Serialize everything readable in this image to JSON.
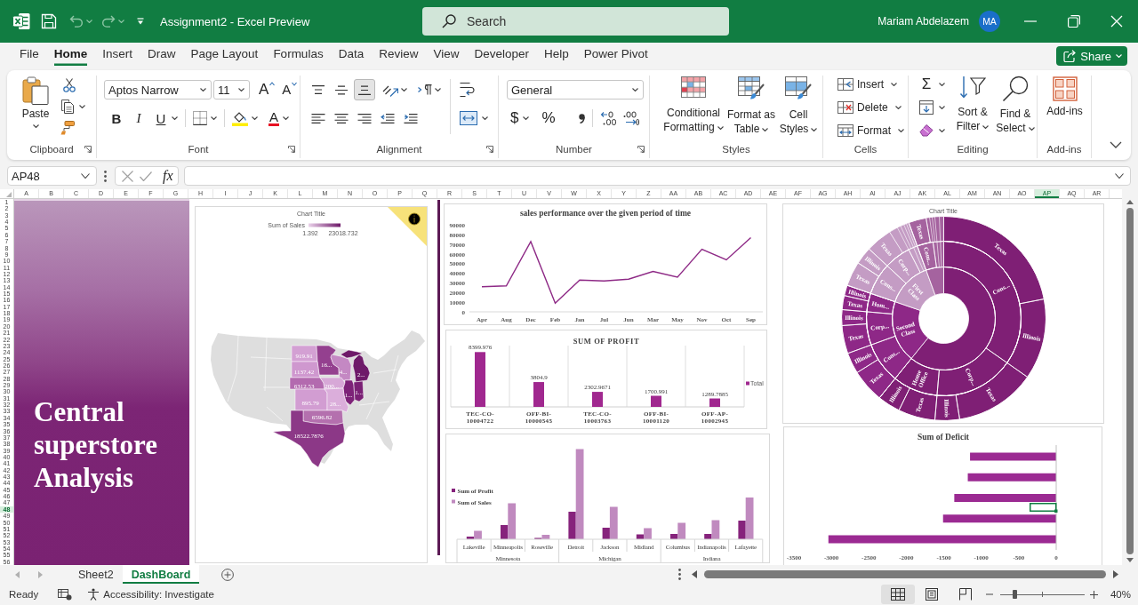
{
  "title_bar": {
    "title": "Assignment2 - Excel Preview",
    "search": {
      "placeholder": "Search"
    },
    "user_name": "Mariam Abdelazem",
    "avatar": "MA"
  },
  "menu_tabs": [
    {
      "label": "File",
      "selected": false
    },
    {
      "label": "Home",
      "selected": true
    },
    {
      "label": "Insert",
      "selected": false
    },
    {
      "label": "Draw",
      "selected": false
    },
    {
      "label": "Page Layout",
      "selected": false
    },
    {
      "label": "Formulas",
      "selected": false
    },
    {
      "label": "Data",
      "selected": false
    },
    {
      "label": "Review",
      "selected": false
    },
    {
      "label": "View",
      "selected": false
    },
    {
      "label": "Developer",
      "selected": false
    },
    {
      "label": "Help",
      "selected": false
    },
    {
      "label": "Power Pivot",
      "selected": false
    }
  ],
  "share_button": "Share",
  "ribbon": {
    "clipboard": {
      "paste": "Paste",
      "label": "Clipboard"
    },
    "font": {
      "font_name": "Aptos Narrow",
      "font_size": "11",
      "grow": "A",
      "shrink": "A",
      "bold": "B",
      "italic": "I",
      "underline": "U",
      "font_color": "A",
      "label": "Font"
    },
    "alignment": {
      "vertical": [
        {
          "kind": "top",
          "selected": false
        },
        {
          "kind": "middle",
          "selected": false
        },
        {
          "kind": "bottom",
          "selected": true
        }
      ],
      "label": "Alignment"
    },
    "number": {
      "format": "General",
      "currency": "$",
      "percent": "%",
      "label": "Number"
    },
    "styles": {
      "buttons": [
        {
          "kind": "conditional",
          "label": "Conditional Formatting"
        },
        {
          "kind": "table",
          "label": "Format as Table"
        },
        {
          "kind": "cell",
          "label": "Cell Styles"
        }
      ],
      "label": "Styles"
    },
    "cells": {
      "buttons": [
        {
          "kind": "insert",
          "label": "Insert"
        },
        {
          "kind": "delete",
          "label": "Delete"
        },
        {
          "kind": "format",
          "label": "Format"
        }
      ],
      "label": "Cells"
    },
    "editing": {
      "sum": "Σ",
      "buttons": [
        {
          "kind": "sort",
          "label": "Sort & Filter"
        },
        {
          "kind": "find",
          "label": "Find & Select"
        }
      ],
      "label": "Editing"
    },
    "addins": {
      "button": "Add-ins",
      "label": "Add-ins"
    }
  },
  "formula_bar": {
    "name_box": "AP48",
    "function_button": "fx"
  },
  "columns": [
    {
      "label": "A",
      "selected": false
    },
    {
      "label": "B",
      "selected": false
    },
    {
      "label": "C",
      "selected": false
    },
    {
      "label": "D",
      "selected": false
    },
    {
      "label": "E",
      "selected": false
    },
    {
      "label": "F",
      "selected": false
    },
    {
      "label": "G",
      "selected": false
    },
    {
      "label": "H",
      "selected": false
    },
    {
      "label": "I",
      "selected": false
    },
    {
      "label": "J",
      "selected": false
    },
    {
      "label": "K",
      "selected": false
    },
    {
      "label": "L",
      "selected": false
    },
    {
      "label": "M",
      "selected": false
    },
    {
      "label": "N",
      "selected": false
    },
    {
      "label": "O",
      "selected": false
    },
    {
      "label": "P",
      "selected": false
    },
    {
      "label": "Q",
      "selected": false
    },
    {
      "label": "R",
      "selected": false
    },
    {
      "label": "S",
      "selected": false
    },
    {
      "label": "T",
      "selected": false
    },
    {
      "label": "U",
      "selected": false
    },
    {
      "label": "V",
      "selected": false
    },
    {
      "label": "W",
      "selected": false
    },
    {
      "label": "X",
      "selected": false
    },
    {
      "label": "Y",
      "selected": false
    },
    {
      "label": "Z",
      "selected": false
    },
    {
      "label": "AA",
      "selected": false
    },
    {
      "label": "AB",
      "selected": false
    },
    {
      "label": "AC",
      "selected": false
    },
    {
      "label": "AD",
      "selected": false
    },
    {
      "label": "AE",
      "selected": false
    },
    {
      "label": "AF",
      "selected": false
    },
    {
      "label": "AG",
      "selected": false
    },
    {
      "label": "AH",
      "selected": false
    },
    {
      "label": "AI",
      "selected": false
    },
    {
      "label": "AJ",
      "selected": false
    },
    {
      "label": "AK",
      "selected": false
    },
    {
      "label": "AL",
      "selected": false
    },
    {
      "label": "AM",
      "selected": false
    },
    {
      "label": "AN",
      "selected": false
    },
    {
      "label": "AO",
      "selected": false
    },
    {
      "label": "AP",
      "selected": true
    },
    {
      "label": "AQ",
      "selected": false
    },
    {
      "label": "AR",
      "selected": false
    }
  ],
  "rows": [
    {
      "label": "1",
      "selected": false
    },
    {
      "label": "2",
      "selected": false
    },
    {
      "label": "3",
      "selected": false
    },
    {
      "label": "4",
      "selected": false
    },
    {
      "label": "5",
      "selected": false
    },
    {
      "label": "6",
      "selected": false
    },
    {
      "label": "7",
      "selected": false
    },
    {
      "label": "8",
      "selected": false
    },
    {
      "label": "9",
      "selected": false
    },
    {
      "label": "10",
      "selected": false
    },
    {
      "label": "11",
      "selected": false
    },
    {
      "label": "12",
      "selected": false
    },
    {
      "label": "13",
      "selected": false
    },
    {
      "label": "14",
      "selected": false
    },
    {
      "label": "15",
      "selected": false
    },
    {
      "label": "16",
      "selected": false
    },
    {
      "label": "17",
      "selected": false
    },
    {
      "label": "18",
      "selected": false
    },
    {
      "label": "19",
      "selected": false
    },
    {
      "label": "20",
      "selected": false
    },
    {
      "label": "21",
      "selected": false
    },
    {
      "label": "22",
      "selected": false
    },
    {
      "label": "23",
      "selected": false
    },
    {
      "label": "24",
      "selected": false
    },
    {
      "label": "25",
      "selected": false
    },
    {
      "label": "26",
      "selected": false
    },
    {
      "label": "27",
      "selected": false
    },
    {
      "label": "28",
      "selected": false
    },
    {
      "label": "29",
      "selected": false
    },
    {
      "label": "30",
      "selected": false
    },
    {
      "label": "31",
      "selected": false
    },
    {
      "label": "32",
      "selected": false
    },
    {
      "label": "33",
      "selected": false
    },
    {
      "label": "34",
      "selected": false
    },
    {
      "label": "35",
      "selected": false
    },
    {
      "label": "36",
      "selected": false
    },
    {
      "label": "37",
      "selected": false
    },
    {
      "label": "38",
      "selected": false
    },
    {
      "label": "39",
      "selected": false
    },
    {
      "label": "40",
      "selected": false
    },
    {
      "label": "41",
      "selected": false
    },
    {
      "label": "42",
      "selected": false
    },
    {
      "label": "43",
      "selected": false
    },
    {
      "label": "44",
      "selected": false
    },
    {
      "label": "45",
      "selected": false
    },
    {
      "label": "46",
      "selected": false
    },
    {
      "label": "47",
      "selected": false
    },
    {
      "label": "48",
      "selected": true
    },
    {
      "label": "49",
      "selected": false
    },
    {
      "label": "50",
      "selected": false
    },
    {
      "label": "51",
      "selected": false
    },
    {
      "label": "52",
      "selected": false
    },
    {
      "label": "53",
      "selected": false
    },
    {
      "label": "54",
      "selected": false
    },
    {
      "label": "55",
      "selected": false
    },
    {
      "label": "56",
      "selected": false
    }
  ],
  "dashboard": {
    "banner": {
      "text": "Central superstore Analysis"
    },
    "map_chart": {
      "title": "Chart Title",
      "legend": {
        "title": "Sum of Sales",
        "min": "1.392",
        "max": "23018.732"
      },
      "regions": [
        {
          "label": "919.91",
          "color": "#d3a0d3"
        },
        {
          "label": "16...",
          "color": "#94408f"
        },
        {
          "label": "1137.42",
          "color": "#cf98cf"
        },
        {
          "label": "4...",
          "color": "#c488c3"
        },
        {
          "label": "2...",
          "color": "#6e1a69"
        },
        {
          "label": "6312.53",
          "color": "#b36aaf"
        },
        {
          "label": "200...",
          "color": "#d7a8d7"
        },
        {
          "label": "1...",
          "color": "#7d2278"
        },
        {
          "label": "1...",
          "color": "#7a2075"
        },
        {
          "label": "895.79",
          "color": "#d29dd2"
        },
        {
          "label": "28...",
          "color": "#dbaedb"
        },
        {
          "label": "6596.82",
          "color": "#b470ae"
        },
        {
          "label": "18522.7876",
          "color": "#8c3887"
        }
      ]
    },
    "sales_chart": {
      "chart_data": {
        "type": "line",
        "title": "sales performance over the given period of time",
        "categories": [
          "Apr",
          "Aug",
          "Dec",
          "Feb",
          "Jan",
          "Jul",
          "Jun",
          "Mar",
          "May",
          "Nov",
          "Oct",
          "Sep"
        ],
        "values": [
          26000,
          27000,
          73000,
          9000,
          33000,
          32000,
          34000,
          42000,
          36000,
          65000,
          54000,
          77000
        ],
        "color": "#8e2a86",
        "ylim": [
          0,
          90000
        ],
        "yticks": [
          0,
          10000,
          20000,
          30000,
          40000,
          50000,
          60000,
          70000,
          80000,
          90000
        ]
      }
    },
    "profit_chart": {
      "chart_data": {
        "type": "bar",
        "title": "SUM OF PROFIT",
        "categories": [
          "TEC-CO-10004722",
          "OFF-BI-10000545",
          "TEC-CO-10003763",
          "OFF-BI-10001120",
          "OFF-AP-10002945"
        ],
        "series": [
          {
            "name": "Total",
            "color": "#a0288f",
            "values": [
              8399.976,
              3804.9,
              2302.9671,
              1700.991,
              1289.7885
            ]
          }
        ],
        "data_labels": true,
        "legend": "right"
      }
    },
    "city_chart": {
      "legend": [
        {
          "label": "Sum of Profit",
          "color": "#86237c"
        },
        {
          "label": "Sum of Sales",
          "color": "#c08abf"
        }
      ],
      "groups": [
        {
          "label": "Minnesota",
          "categories": [
            "Lakeville",
            "Minneapolis",
            "Roseville"
          ]
        },
        {
          "label": "Michigan",
          "categories": [
            "Detroit",
            "Jackson",
            "Midland"
          ]
        },
        {
          "label": "Indiana",
          "categories": [
            "Columbus",
            "Indianapolis",
            "Lafayette"
          ]
        }
      ]
    },
    "sunburst": {
      "title": "Chart Title",
      "segments": [
        {
          "color": "#7f1f75",
          "children": [
            {
              "label": "Cons...",
              "children": [
                {
                  "label": "Texas"
                },
                {
                  "label": "Illinois"
                }
              ]
            },
            {
              "label": "Corp...",
              "children": [
                {
                  "label": "Texas"
                },
                {
                  "label": "Illinois"
                }
              ]
            },
            {
              "label": "Home Office",
              "children": [
                {
                  "label": "Texas"
                },
                {
                  "label": "Illinois"
                }
              ]
            }
          ]
        },
        {
          "label": "Second Class",
          "color": "#8e2887",
          "children": [
            {
              "label": "Cons...",
              "children": [
                {
                  "label": "Texas"
                },
                {
                  "label": "Illinois"
                }
              ]
            },
            {
              "label": "Corp...",
              "children": [
                {
                  "label": "Texas"
                },
                {
                  "label": "Illinois"
                }
              ]
            },
            {
              "label": "Hom...",
              "children": [
                {
                  "label": "Texas"
                },
                {
                  "label": "Illinois"
                }
              ]
            }
          ]
        },
        {
          "label": "First Class",
          "color": "#c49cc4",
          "children": [
            {
              "label": "Cons...",
              "children": [
                {
                  "label": "Texas"
                },
                {
                  "label": "Illinois"
                }
              ]
            },
            {
              "label": "Corp...",
              "children": [
                {
                  "label": "Texas"
                }
              ]
            }
          ]
        },
        {
          "color": "#a5639f",
          "children": [
            {
              "label": "Cons...",
              "children": [
                {
                  "label": "Texas"
                }
              ]
            }
          ]
        }
      ]
    },
    "deficit_chart": {
      "chart_data": {
        "type": "bar",
        "orientation": "horizontal",
        "title": "Sum of Deficit",
        "categories": [
          null,
          null,
          null,
          null,
          null
        ],
        "values": [
          -1150,
          -1180,
          -1360,
          -1510,
          -3040
        ],
        "color": "#9b2a92",
        "xlim": [
          -3500,
          0
        ],
        "xticks": [
          -3500,
          -3000,
          -2500,
          -2000,
          -1500,
          -1000,
          -500,
          0
        ]
      }
    }
  },
  "sheet_tabs": [
    {
      "label": "Sheet2",
      "selected": false
    },
    {
      "label": "DashBoard",
      "selected": true
    }
  ],
  "status_bar": {
    "mode": "Ready",
    "accessibility": "Accessibility: Investigate",
    "views": [
      {
        "kind": "normal",
        "selected": true
      },
      {
        "kind": "page_layout",
        "selected": false
      },
      {
        "kind": "page_break",
        "selected": false
      }
    ],
    "zoom": {
      "level": 0.17,
      "label": "40%"
    }
  }
}
